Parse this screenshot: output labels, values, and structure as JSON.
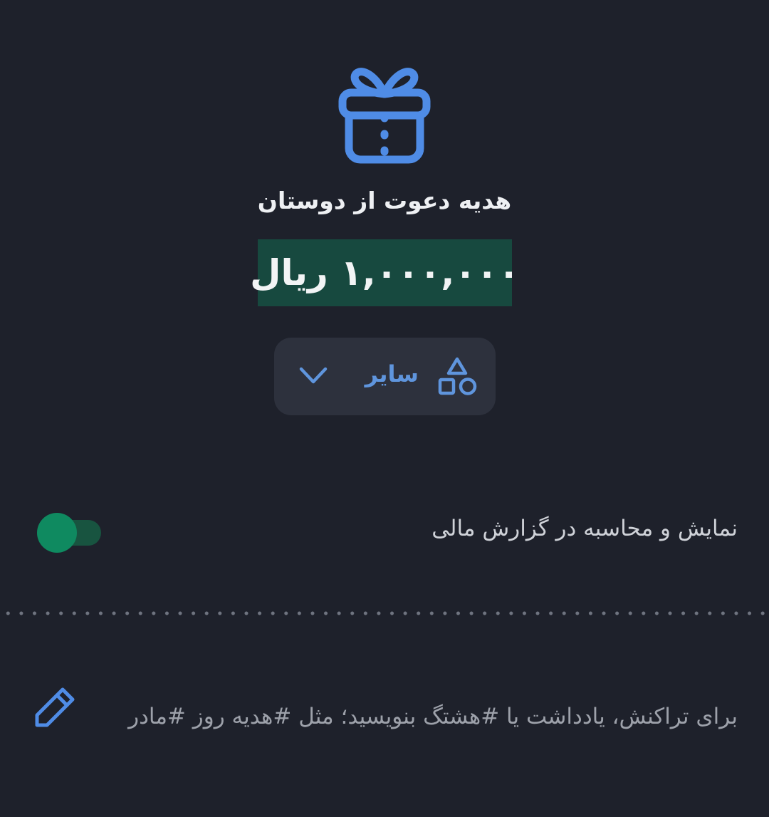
{
  "header": {
    "icon": "gift-icon",
    "title": "هدیه دعوت از دوستان",
    "amount": "۱,۰۰۰,۰۰۰ ریال"
  },
  "category": {
    "icon": "shapes-icon",
    "label": "سایر",
    "dropdown_icon": "chevron-down-icon"
  },
  "report": {
    "label": "نمایش و محاسبه در گزارش مالی",
    "toggle_on": true
  },
  "note": {
    "icon": "pencil-icon",
    "placeholder": "برای تراکنش، یادداشت یا #هشتگ بنویسید؛ مثل #هدیه روز #مادر"
  },
  "colors": {
    "background": "#1e212b",
    "accent_blue": "#4f8ce6",
    "amount_bg": "#17493f",
    "toggle_green": "#0f8a60",
    "pill_bg": "#2d313d"
  }
}
